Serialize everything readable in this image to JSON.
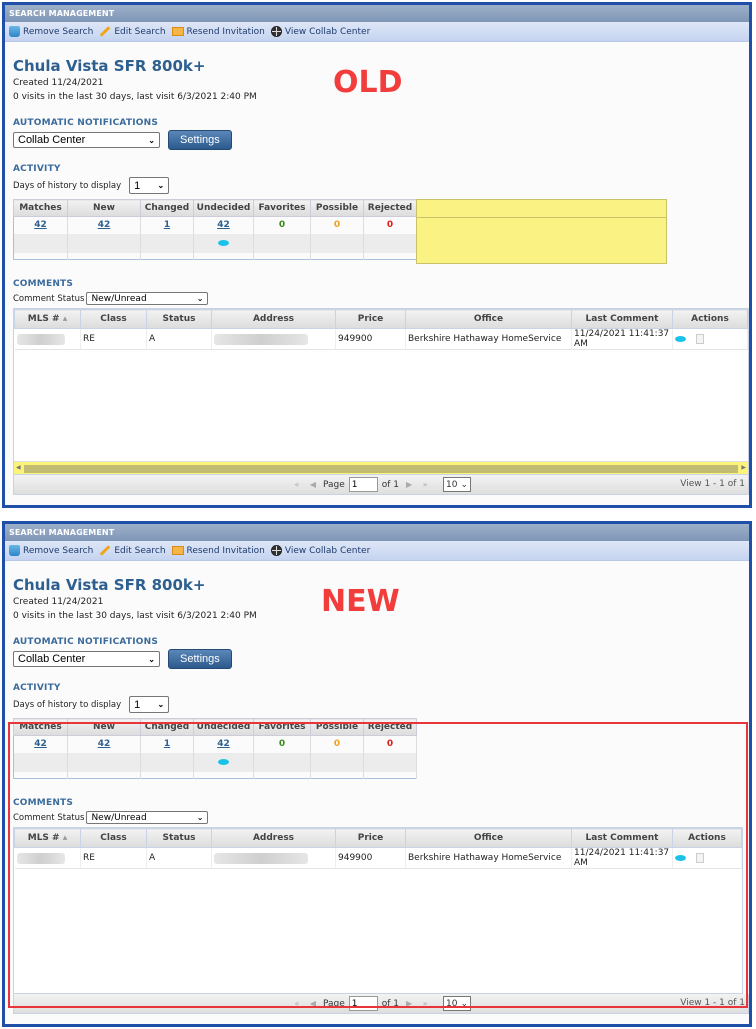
{
  "panels": {
    "old": {
      "stamp": "OLD",
      "highlight": "yellow",
      "highlight_color": "#faf06e"
    },
    "new": {
      "stamp": "NEW",
      "highlight": "red-outline",
      "highlight_color": "#e8353b"
    }
  },
  "window": {
    "title": "SEARCH MANAGEMENT"
  },
  "toolbar": {
    "items": [
      {
        "label": "Remove Search",
        "icon": "trash-icon"
      },
      {
        "label": "Edit Search",
        "icon": "pencil-icon"
      },
      {
        "label": "Resend Invitation",
        "icon": "mail-icon"
      },
      {
        "label": "View Collab Center",
        "icon": "globe-icon"
      }
    ]
  },
  "search": {
    "title": "Chula Vista SFR 800k+",
    "created": "Created 11/24/2021",
    "visits": "0 visits in the last 30 days, last visit 6/3/2021 2:40 PM"
  },
  "notifications": {
    "heading": "AUTOMATIC NOTIFICATIONS",
    "selected": "Collab Center",
    "settings_label": "Settings"
  },
  "activity": {
    "heading": "ACTIVITY",
    "days_label": "Days of history to display",
    "days_selected": "1",
    "columns": [
      "Matches",
      "New",
      "Changed",
      "Undecided",
      "Favorites",
      "Possible",
      "Rejected"
    ],
    "values": [
      "42",
      "42",
      "1",
      "42",
      "0",
      "0",
      "0"
    ]
  },
  "comments": {
    "heading": "COMMENTS",
    "status_label": "Comment Status",
    "status_selected": "New/Unread",
    "columns": [
      "MLS # ⬧",
      "Class",
      "Status",
      "Address",
      "Price",
      "Office",
      "Last Comment",
      "Actions"
    ],
    "mls_header": "MLS #",
    "sort_glyph": "▴",
    "rows": [
      {
        "mls": "",
        "class": "RE",
        "status": "A",
        "address": "",
        "price": "949900",
        "office": "Berkshire Hathaway HomeService",
        "last_comment": "11/24/2021 11:41:37 AM"
      }
    ]
  },
  "pager": {
    "page_label": "Page",
    "page_value": "1",
    "of_label": "of 1",
    "rows_per_page": "10",
    "view_info": "View 1 - 1 of 1"
  }
}
